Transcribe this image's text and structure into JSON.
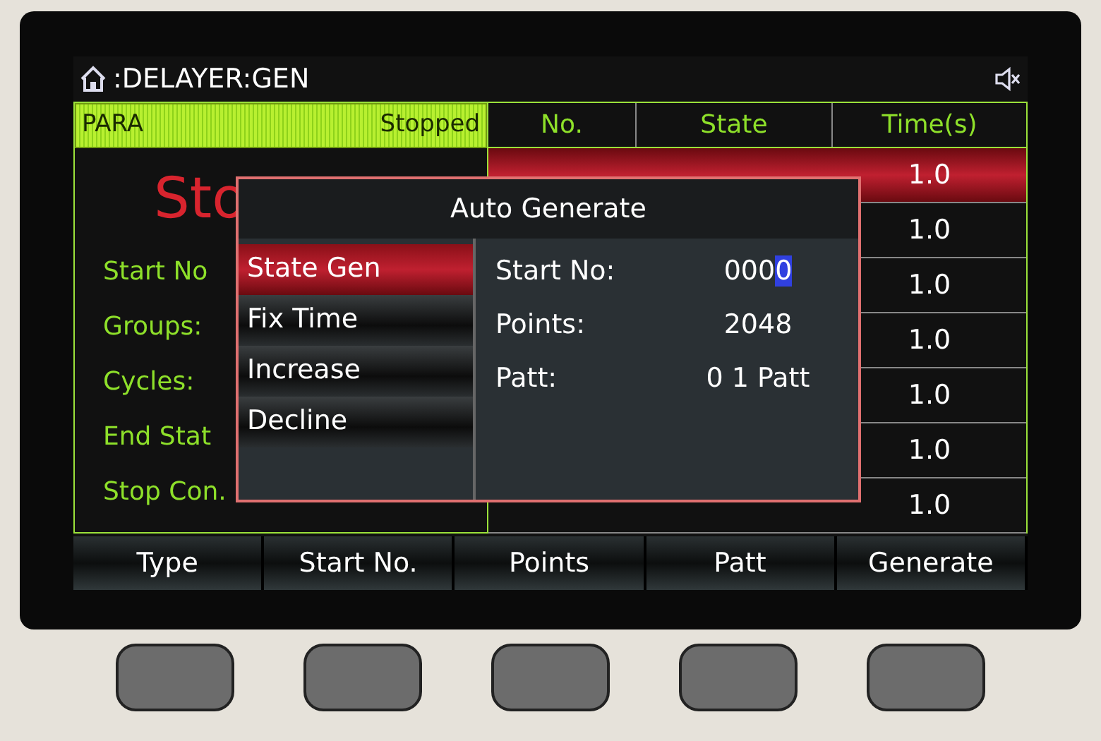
{
  "header": {
    "path": ":DELAYER:GEN",
    "muted": true
  },
  "status_panel": {
    "title": "PARA",
    "status": "Stopped",
    "big_state": "Sto",
    "labels": [
      "Start No",
      "Groups:",
      "Cycles:",
      "End Stat",
      "Stop Con."
    ]
  },
  "table": {
    "columns": [
      "No.",
      "State",
      "Time(s)"
    ],
    "rows": [
      {
        "time": "1.0",
        "selected": true
      },
      {
        "time": "1.0",
        "selected": false
      },
      {
        "time": "1.0",
        "selected": false
      },
      {
        "time": "1.0",
        "selected": false
      },
      {
        "time": "1.0",
        "selected": false
      },
      {
        "time": "1.0",
        "selected": false
      },
      {
        "time": "1.0",
        "selected": false
      }
    ]
  },
  "dialog": {
    "title": "Auto Generate",
    "types": [
      {
        "label": "State Gen",
        "selected": true
      },
      {
        "label": "Fix Time",
        "selected": false
      },
      {
        "label": "Increase",
        "selected": false
      },
      {
        "label": "Decline",
        "selected": false
      }
    ],
    "fields": [
      {
        "label": "Start No:",
        "value": "0000",
        "editing": true
      },
      {
        "label": "Points:",
        "value": "2048",
        "editing": false
      },
      {
        "label": "Patt:",
        "value": "0 1 Patt",
        "editing": false
      }
    ]
  },
  "softkeys": [
    "Type",
    "Start No.",
    "Points",
    "Patt",
    "Generate"
  ]
}
